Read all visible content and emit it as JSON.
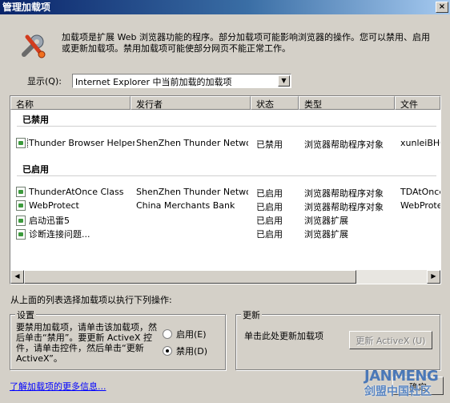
{
  "window": {
    "title": "管理加载项",
    "close_label": "×"
  },
  "description": "加载项是扩展 Web 浏览器功能的程序。部分加载项可能影响浏览器的操作。您可以禁用、启用或更新加载项。禁用加载项可能使部分网页不能正常工作。",
  "show": {
    "label": "显示(Q):",
    "selected": "Internet Explorer 中当前加载的加载项"
  },
  "list": {
    "columns": [
      "名称",
      "发行者",
      "状态",
      "类型",
      "文件"
    ],
    "groups": [
      {
        "label": "已禁用",
        "rows": [
          {
            "name": "Thunder Browser Helper",
            "publisher": "ShenZhen Thunder Netwo...",
            "status": "已禁用",
            "type": "浏览器帮助程序对象",
            "file": "xunleiBHO_"
          }
        ]
      },
      {
        "label": "已启用",
        "rows": [
          {
            "name": "ThunderAtOnce Class",
            "publisher": "ShenZhen Thunder Netwo...",
            "status": "已启用",
            "type": "浏览器帮助程序对象",
            "file": "TDAtOnce_A"
          },
          {
            "name": "WebProtect",
            "publisher": "China Merchants Bank",
            "status": "已启用",
            "type": "浏览器帮助程序对象",
            "file": "WebProtect"
          },
          {
            "name": "启动迅雷5",
            "publisher": "",
            "status": "已启用",
            "type": "浏览器扩展",
            "file": ""
          },
          {
            "name": "诊断连接问题...",
            "publisher": "",
            "status": "已启用",
            "type": "浏览器扩展",
            "file": ""
          }
        ]
      }
    ]
  },
  "instruction": "从上面的列表选择加载项以执行下列操作:",
  "settings": {
    "title": "设置",
    "text": "要禁用加载项，请单击该加载项，然后单击“禁用”。要更新 ActiveX 控件，请单击控件，然后单击“更新 ActiveX”。",
    "enable_label": "启用(E)",
    "disable_label": "禁用(D)",
    "selected": "disable"
  },
  "update": {
    "title": "更新",
    "text": "单击此处更新加载项",
    "button_label": "更新 ActiveX (U)"
  },
  "learn_more_link": "了解加载项的更多信息...",
  "ok_label": "确定",
  "watermark": {
    "top": "JANMENG",
    "bottom": "剑盟中国社区"
  }
}
